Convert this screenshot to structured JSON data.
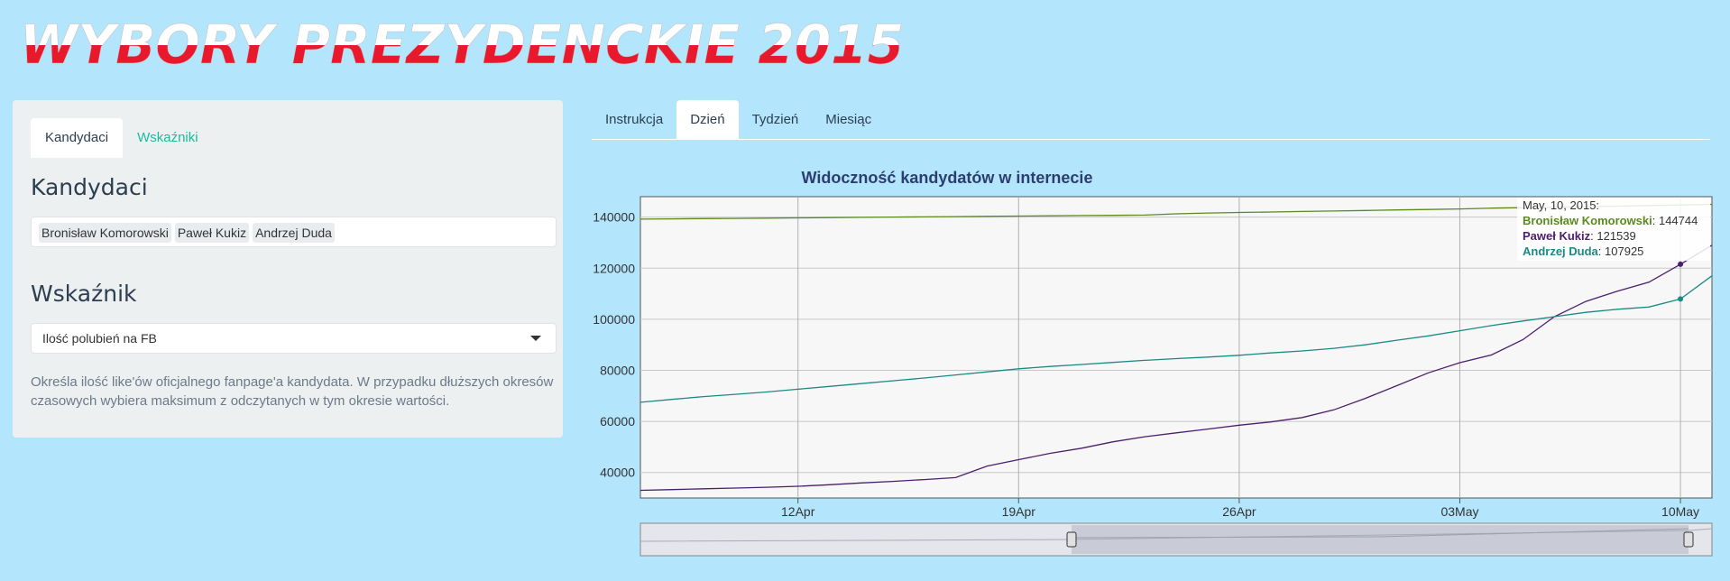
{
  "app": {
    "title": "WYBORY PREZYDENCKIE 2015"
  },
  "sidebar": {
    "tabs": [
      {
        "label": "Kandydaci",
        "active": true
      },
      {
        "label": "Wskaźniki",
        "active": false
      }
    ],
    "candidates_heading": "Kandydaci",
    "selected_candidates": [
      "Bronisław Komorowski",
      "Paweł Kukiz",
      "Andrzej Duda"
    ],
    "indicator_heading": "Wskaźnik",
    "indicator_selected": "Ilość polubień na FB",
    "help_text": "Określa ilość like'ów oficjalnego fanpage'a kandydata. W przypadku dłuższych okresów czasowych wybiera maksimum z odczytanych w tym okresie wartości."
  },
  "main_tabs": [
    {
      "label": "Instrukcja",
      "active": false
    },
    {
      "label": "Dzień",
      "active": true
    },
    {
      "label": "Tydzień",
      "active": false
    },
    {
      "label": "Miesiąc",
      "active": false
    }
  ],
  "colors": {
    "komorowski": "#5a8a1e",
    "kukiz": "#4b1f6b",
    "duda": "#1a8a84",
    "title_top": "#ffffff",
    "title_bottom": "#e8192c"
  },
  "chart_data": {
    "type": "line",
    "title": "Widoczność kandydatów w internecie",
    "x_ticks": [
      "12Apr",
      "19Apr",
      "26Apr",
      "03May",
      "10May"
    ],
    "y_ticks": [
      40000,
      60000,
      80000,
      100000,
      120000,
      140000
    ],
    "xlim": [
      "2015-04-07",
      "2015-05-11"
    ],
    "ylim": [
      30000,
      148000
    ],
    "grid": true,
    "x": [
      "2015-04-07",
      "2015-04-08",
      "2015-04-09",
      "2015-04-10",
      "2015-04-11",
      "2015-04-12",
      "2015-04-13",
      "2015-04-14",
      "2015-04-15",
      "2015-04-16",
      "2015-04-17",
      "2015-04-18",
      "2015-04-19",
      "2015-04-20",
      "2015-04-21",
      "2015-04-22",
      "2015-04-23",
      "2015-04-24",
      "2015-04-25",
      "2015-04-26",
      "2015-04-27",
      "2015-04-28",
      "2015-04-29",
      "2015-04-30",
      "2015-05-01",
      "2015-05-02",
      "2015-05-03",
      "2015-05-04",
      "2015-05-05",
      "2015-05-06",
      "2015-05-07",
      "2015-05-08",
      "2015-05-09",
      "2015-05-10",
      "2015-05-11"
    ],
    "series": [
      {
        "name": "Bronisław Komorowski",
        "color_key": "komorowski",
        "values": [
          139200,
          139300,
          139400,
          139500,
          139600,
          139700,
          139800,
          139900,
          140000,
          140100,
          140200,
          140300,
          140400,
          140500,
          140600,
          140700,
          140800,
          141300,
          141600,
          141800,
          142000,
          142200,
          142400,
          142600,
          142800,
          143000,
          143200,
          143500,
          143700,
          143900,
          144100,
          144300,
          144500,
          144744,
          145000
        ]
      },
      {
        "name": "Paweł Kukiz",
        "color_key": "kukiz",
        "values": [
          33000,
          33300,
          33600,
          33900,
          34200,
          34600,
          35200,
          35900,
          36500,
          37200,
          38000,
          42500,
          45000,
          47500,
          49500,
          52000,
          54000,
          55500,
          57000,
          58500,
          59800,
          61500,
          64500,
          69000,
          74000,
          79000,
          83000,
          86000,
          92000,
          101000,
          107000,
          111000,
          114500,
          121539,
          129000
        ]
      },
      {
        "name": "Andrzej Duda",
        "color_key": "duda",
        "values": [
          67500,
          68600,
          69700,
          70600,
          71500,
          72600,
          73700,
          74800,
          75900,
          77000,
          78200,
          79400,
          80600,
          81500,
          82300,
          83100,
          83900,
          84600,
          85200,
          85900,
          86800,
          87600,
          88600,
          90000,
          91800,
          93500,
          95500,
          97500,
          99300,
          101000,
          102700,
          103900,
          104800,
          107925,
          117000
        ]
      }
    ],
    "tooltip": {
      "date": "May, 10, 2015:",
      "entries": [
        {
          "name": "Bronisław Komorowski",
          "value": "144744",
          "color_key": "komorowski"
        },
        {
          "name": "Paweł Kukiz",
          "value": "121539",
          "color_key": "kukiz"
        },
        {
          "name": "Andrzej Duda",
          "value": "107925",
          "color_key": "duda"
        }
      ]
    }
  }
}
